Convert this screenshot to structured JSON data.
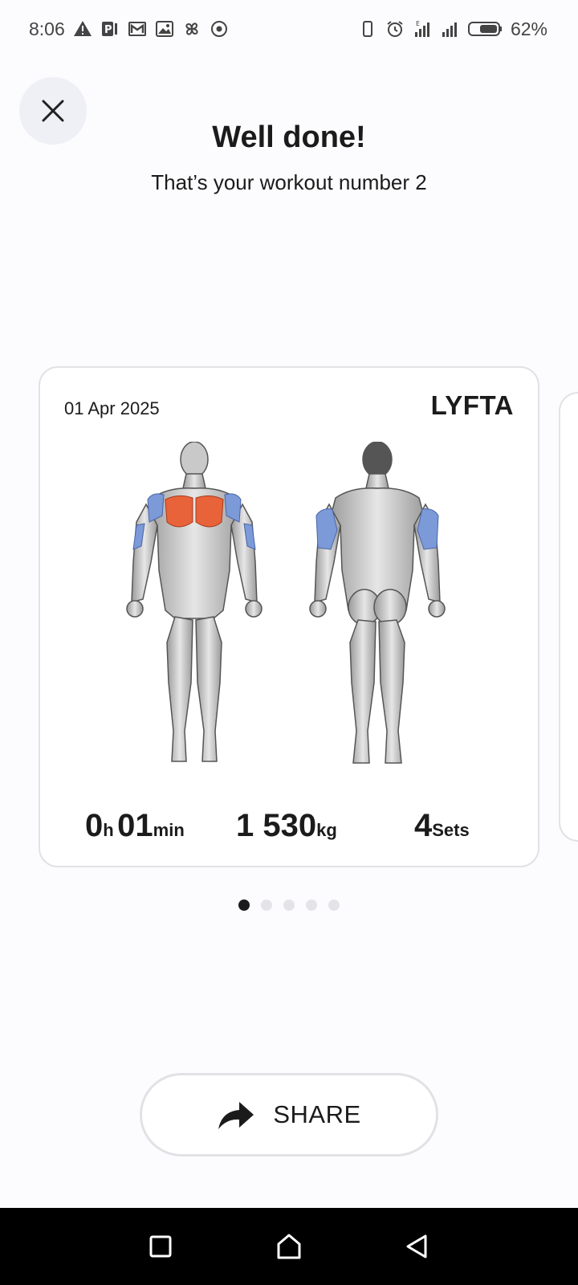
{
  "status_bar": {
    "time": "8:06",
    "battery": "62%",
    "left_icons": [
      "warning-icon",
      "parking-icon",
      "gmail-icon",
      "image-icon",
      "pinwheel-icon",
      "record-icon"
    ],
    "right_icons": [
      "vibrate-icon",
      "alarm-icon",
      "signal-e-icon",
      "signal-icon",
      "battery-icon"
    ]
  },
  "header": {
    "title": "Well done!",
    "subtitle": "That’s your workout number 2"
  },
  "card": {
    "date": "01 Apr 2025",
    "brand": "LYFTA",
    "highlighted_muscles": [
      "chest",
      "front-delts",
      "triceps"
    ],
    "colors": {
      "chest": "#e8633a",
      "secondary": "#7d9ad8"
    },
    "stats": {
      "hours": "0",
      "hours_unit": "h",
      "minutes": "01",
      "minutes_unit": "min",
      "volume": "1 530",
      "volume_unit": "kg",
      "sets": "4",
      "sets_unit": "Sets"
    }
  },
  "pager": {
    "count": 5,
    "active": 0
  },
  "share_button": {
    "label": "SHARE",
    "icon": "share-arrow-icon"
  },
  "nav_bar": {
    "buttons": [
      "recents-icon",
      "home-icon",
      "back-icon"
    ]
  }
}
